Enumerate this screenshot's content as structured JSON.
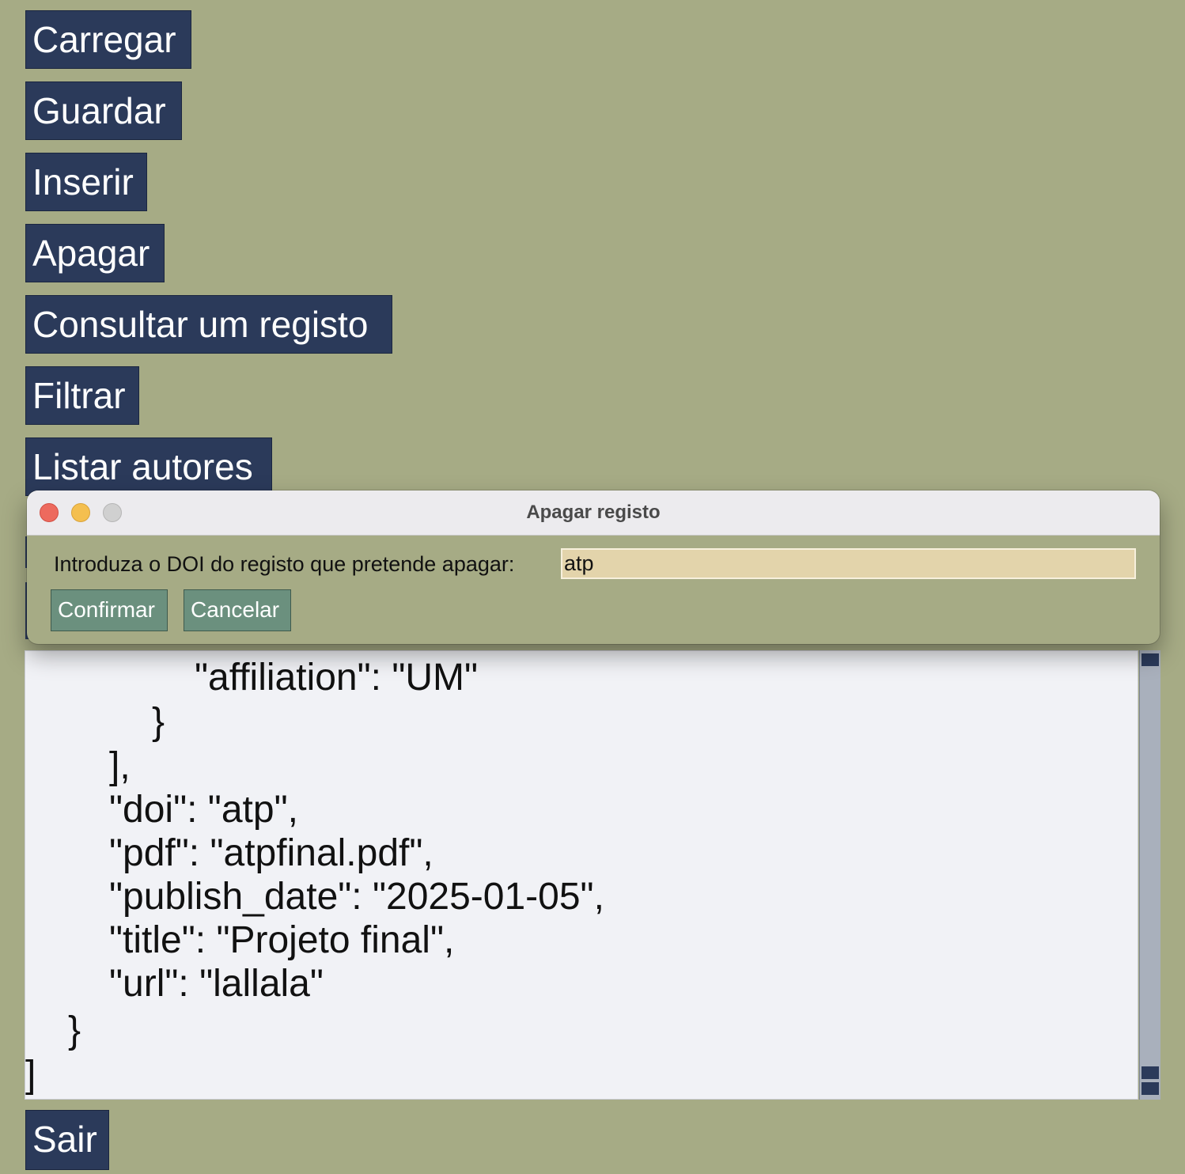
{
  "menu": {
    "carregar": "Carregar",
    "guardar": "Guardar",
    "inserir": "Inserir",
    "apagar": "Apagar",
    "consultar": "Consultar um registo",
    "filtrar": "Filtrar",
    "listar_autores": "Listar autores",
    "sair": "Sair"
  },
  "dialog": {
    "title": "Apagar registo",
    "prompt": "Introduza o DOI do registo que pretende apagar:",
    "doi_value": "atp",
    "confirm_label": "Confirmar",
    "cancel_label": "Cancelar"
  },
  "json_view": {
    "lines": [
      "\"affiliation\": \"UM\"",
      "}",
      "],",
      "\"doi\": \"atp\",",
      "\"pdf\": \"atpfinal.pdf\",",
      "\"publish_date\": \"2025-01-05\",",
      "\"title\": \"Projeto final\",",
      "\"url\": \"lallala\"",
      "}",
      "]"
    ]
  },
  "colors": {
    "background": "#a6ab85",
    "menu_button": "#2b3a5a",
    "dialog_button": "#6b907e",
    "input_bg": "#e3d4ab",
    "text_area_bg": "#f1f2f6"
  }
}
